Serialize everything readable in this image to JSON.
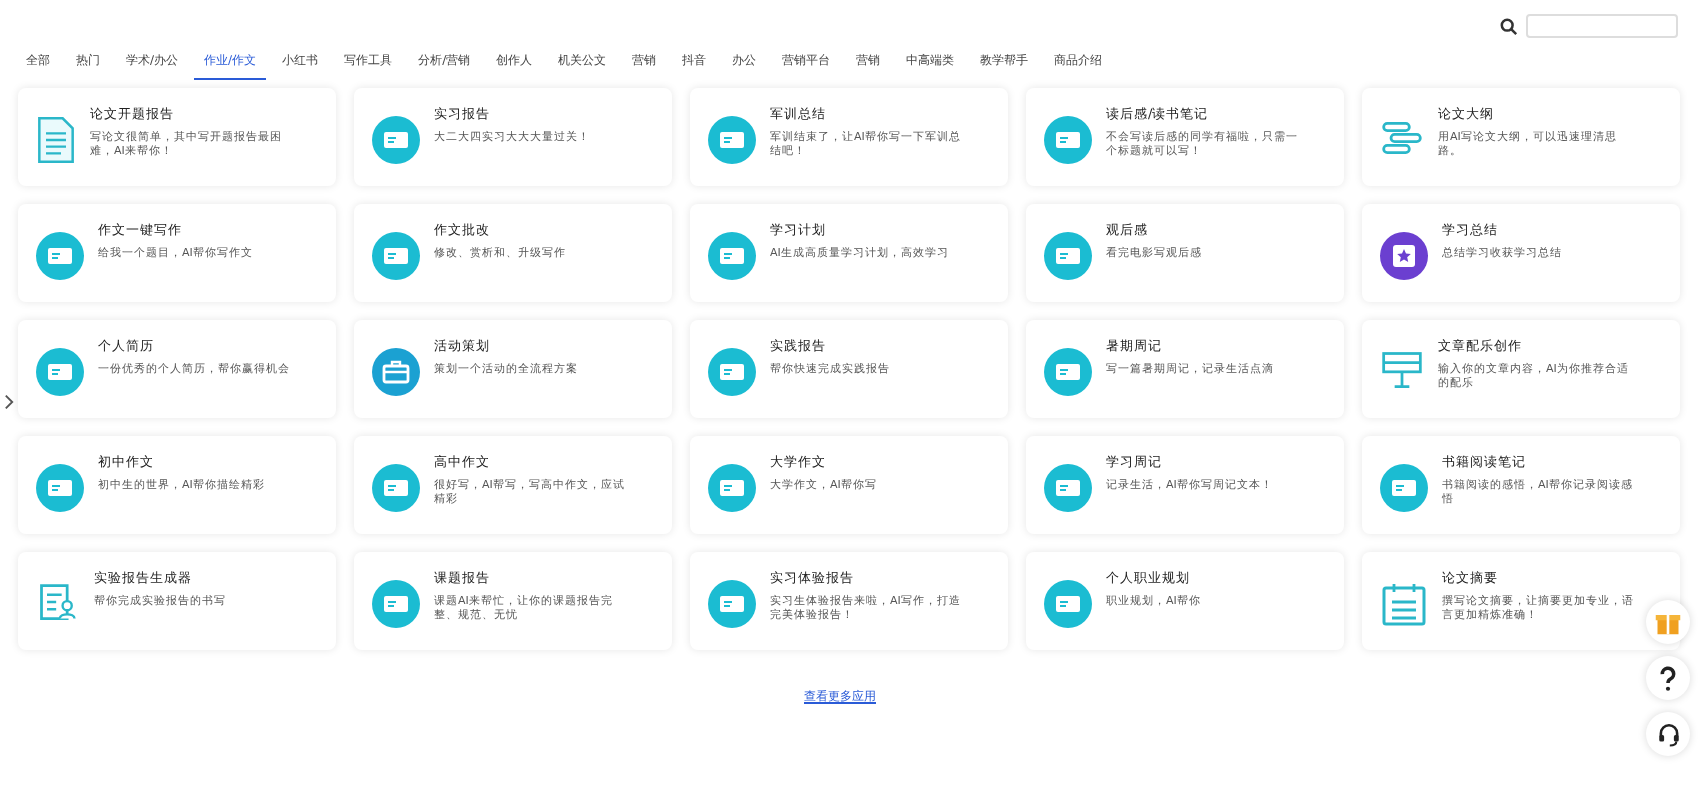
{
  "tabs": [
    {
      "label": "全部",
      "selected": false
    },
    {
      "label": "热门",
      "selected": false
    },
    {
      "label": "学术/办公",
      "selected": false
    },
    {
      "label": "作业/作文",
      "selected": true
    },
    {
      "label": "小红书",
      "selected": false
    },
    {
      "label": "写作工具",
      "selected": false
    },
    {
      "label": "分析/营销",
      "selected": false
    },
    {
      "label": "创作人",
      "selected": false
    },
    {
      "label": "机关公文",
      "selected": false
    },
    {
      "label": "营销",
      "selected": false
    },
    {
      "label": "抖音",
      "selected": false
    },
    {
      "label": "办公",
      "selected": false
    },
    {
      "label": "营销平台",
      "selected": false
    },
    {
      "label": "营销",
      "selected": false
    },
    {
      "label": "中高端类",
      "selected": false
    },
    {
      "label": "教学帮手",
      "selected": false
    },
    {
      "label": "商品介绍",
      "selected": false
    }
  ],
  "cards": [
    {
      "kind": "doc",
      "title": "论文开题报告",
      "desc": "写论文很简单，其中写开题报告最困难，AI来帮你！"
    },
    {
      "kind": "circle",
      "title": "实习报告",
      "desc": "大二大四实习大大大量过关！"
    },
    {
      "kind": "circle",
      "title": "军训总结",
      "desc": "军训结束了，让AI帮你写一下军训总结吧！"
    },
    {
      "kind": "circle",
      "title": "读后感/读书笔记",
      "desc": "不会写读后感的同学有福啦，只需一个标题就可以写！"
    },
    {
      "kind": "outline",
      "title": "论文大纲",
      "desc": "用AI写论文大纲，可以迅速理清思路。"
    },
    {
      "kind": "circle",
      "title": "作文一键写作",
      "desc": "给我一个题目，AI帮你写作文"
    },
    {
      "kind": "circle",
      "title": "作文批改",
      "desc": "修改、赏析和、升级写作"
    },
    {
      "kind": "circle",
      "title": "学习计划",
      "desc": "AI生成高质量学习计划，高效学习"
    },
    {
      "kind": "circle",
      "title": "观后感",
      "desc": "看完电影写观后感"
    },
    {
      "kind": "star",
      "title": "学习总结",
      "desc": "总结学习收获学习总结"
    },
    {
      "kind": "circle",
      "title": "个人简历",
      "desc": "一份优秀的个人简历，帮你赢得机会"
    },
    {
      "kind": "case",
      "title": "活动策划",
      "desc": "策划一个活动的全流程方案"
    },
    {
      "kind": "circle",
      "title": "实践报告",
      "desc": "帮你快速完成实践报告"
    },
    {
      "kind": "circle",
      "title": "暑期周记",
      "desc": "写一篇暑期周记，记录生活点滴"
    },
    {
      "kind": "board",
      "title": "文章配乐创作",
      "desc": "输入你的文章内容，AI为你推荐合适的配乐"
    },
    {
      "kind": "circle",
      "title": "初中作文",
      "desc": "初中生的世界，AI帮你描绘精彩"
    },
    {
      "kind": "circle",
      "title": "高中作文",
      "desc": "很好写，AI帮写，写高中作文，应试精彩"
    },
    {
      "kind": "circle",
      "title": "大学作文",
      "desc": "大学作文，AI帮你写"
    },
    {
      "kind": "circle",
      "title": "学习周记",
      "desc": "记录生活，AI帮你写周记文本！"
    },
    {
      "kind": "circle",
      "title": "书籍阅读笔记",
      "desc": "书籍阅读的感悟，AI帮你记录阅读感悟"
    },
    {
      "kind": "form",
      "title": "实验报告生成器",
      "desc": "帮你完成实验报告的书写"
    },
    {
      "kind": "circle",
      "title": "课题报告",
      "desc": "课题AI来帮忙，让你的课题报告完整、规范、无忧"
    },
    {
      "kind": "circle",
      "title": "实习体验报告",
      "desc": "实习生体验报告来啦，AI写作，打造完美体验报告！"
    },
    {
      "kind": "circle",
      "title": "个人职业规划",
      "desc": "职业规划，AI帮你"
    },
    {
      "kind": "calendar",
      "title": "论文摘要",
      "desc": "撰写论文摘要，让摘要更加专业，语言更加精炼准确！"
    }
  ],
  "more_link": "查看更多应用"
}
